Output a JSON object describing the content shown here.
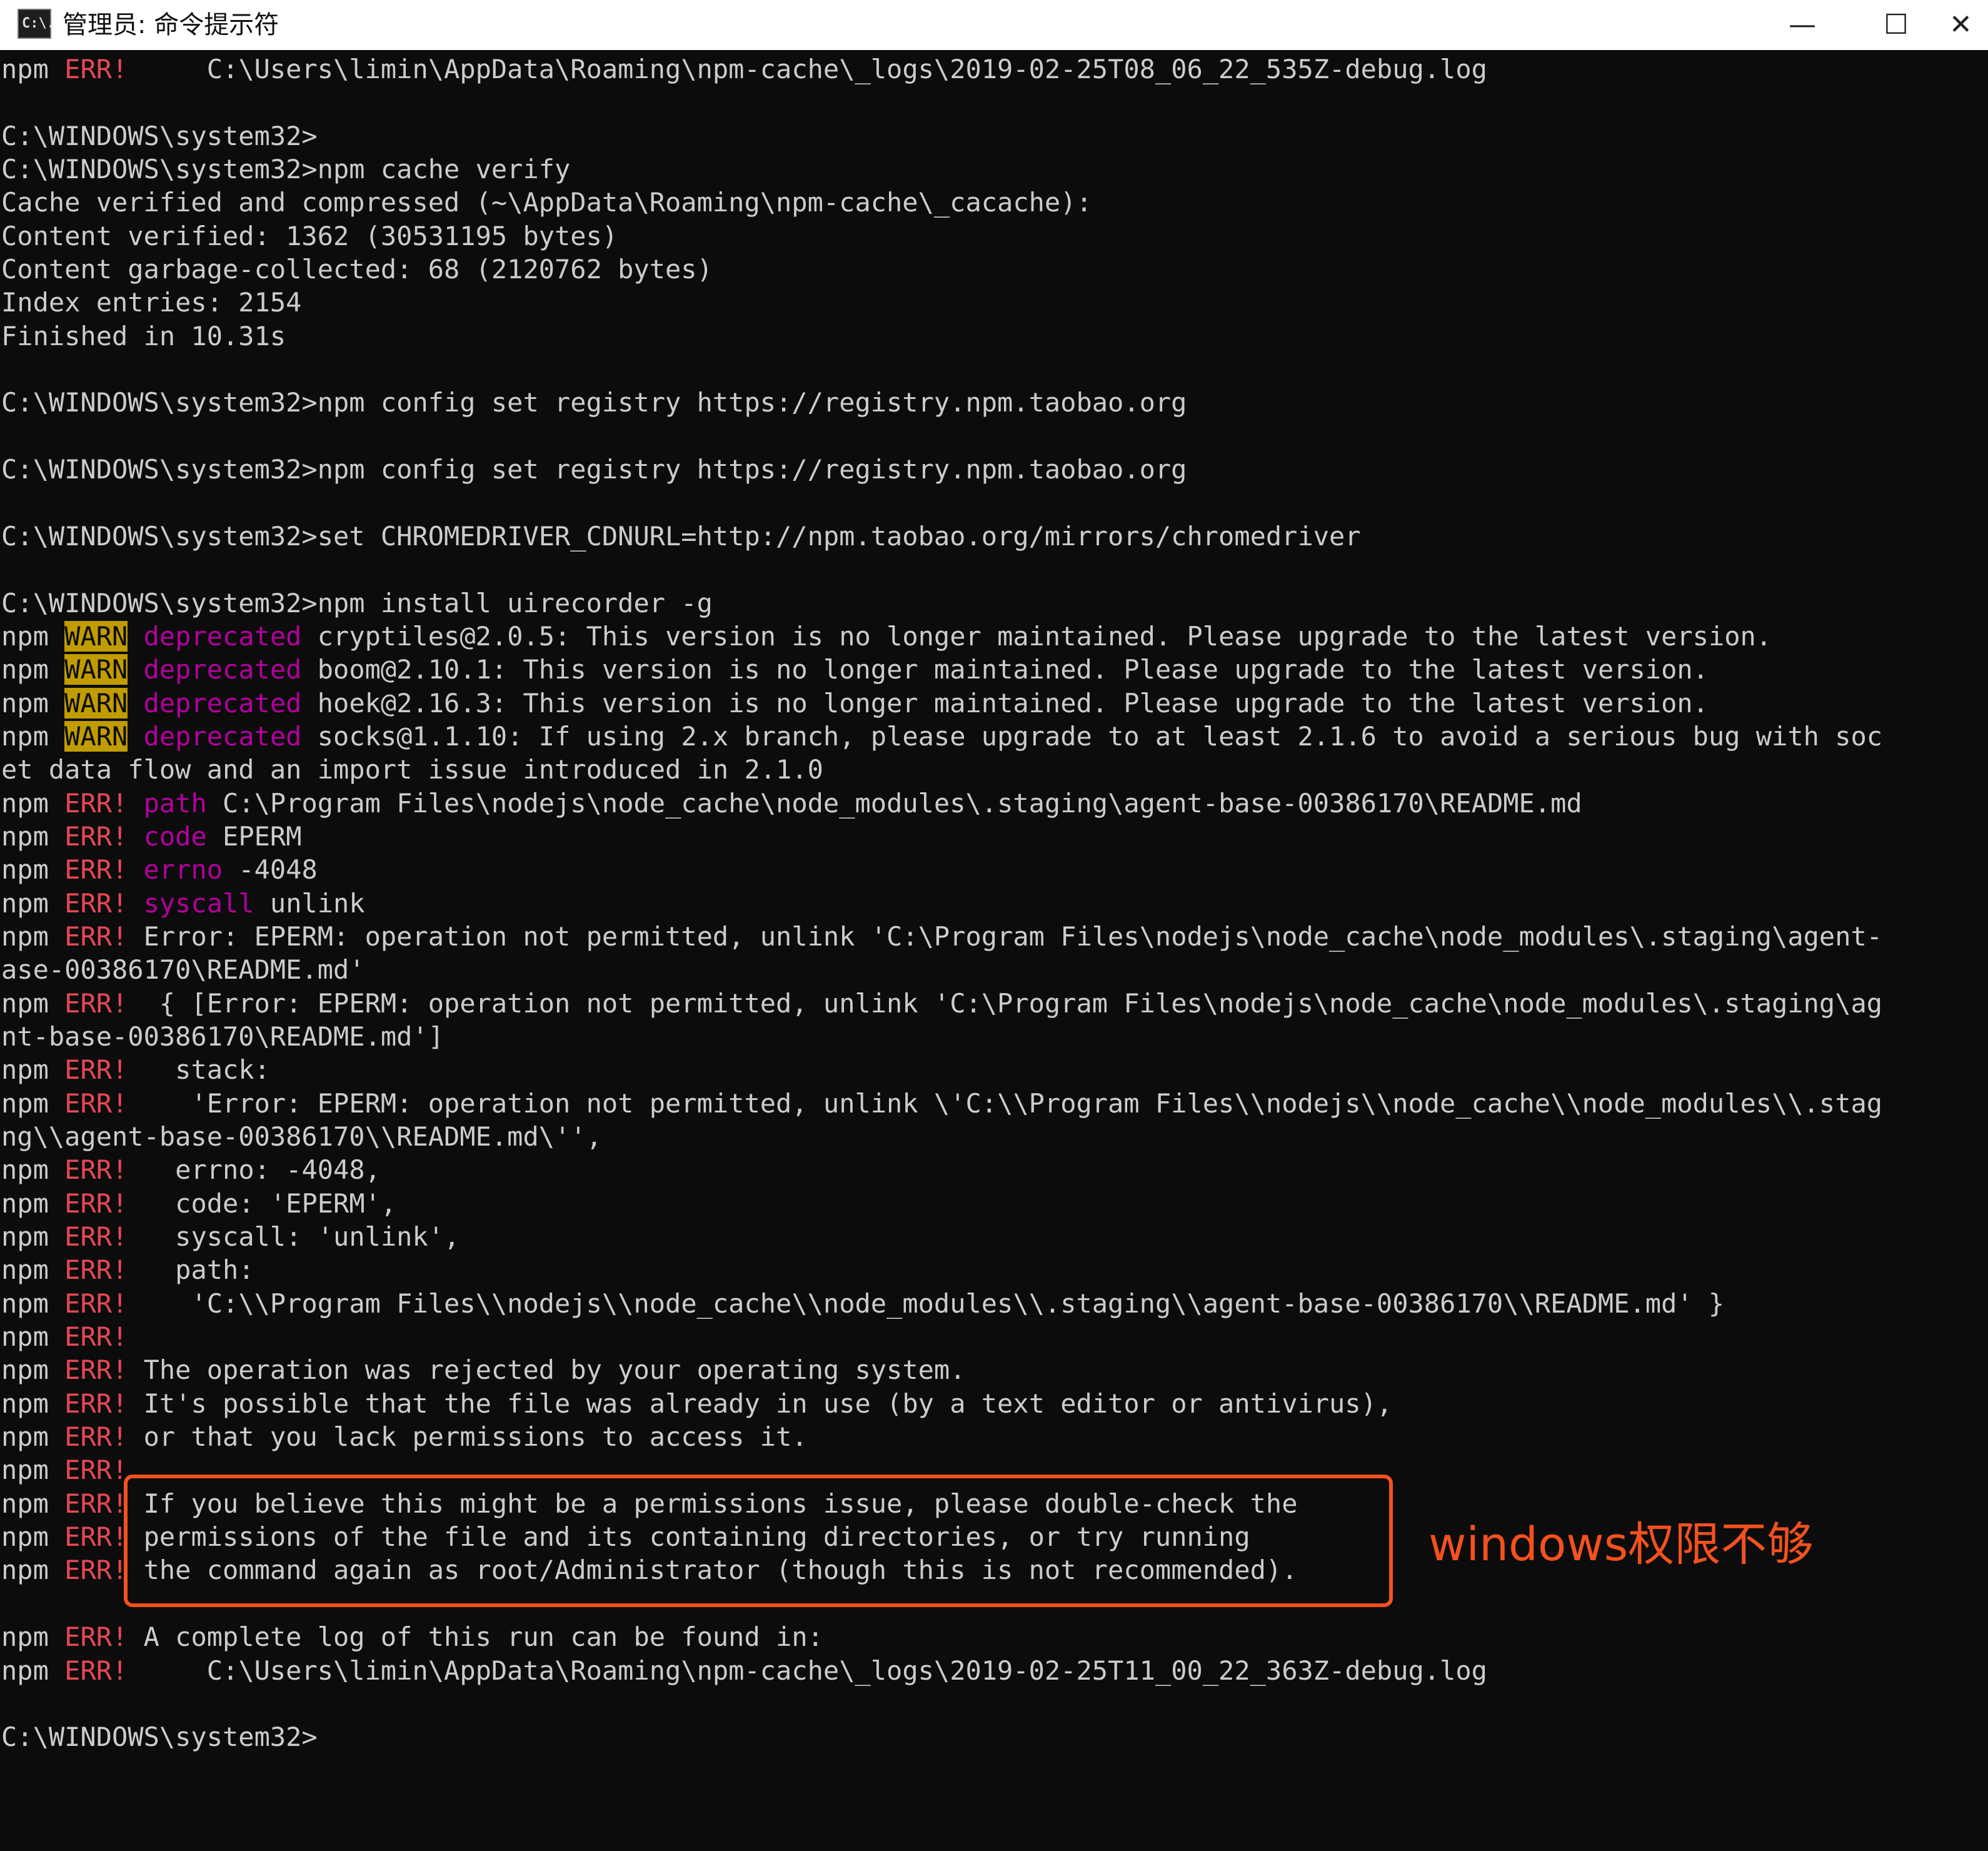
{
  "window": {
    "title": "管理员: 命令提示符",
    "icon_label": "C:\\.",
    "minimize_glyph": "—",
    "maximize_glyph": "☐",
    "close_glyph": "✕"
  },
  "colors": {
    "err": "#e74856",
    "warn_bg": "#c19c00",
    "deprecated": "#b4009e",
    "highlight": "#f4511e"
  },
  "lines": [
    [
      "npm ",
      {
        "t": "ERR!",
        "c": "err"
      },
      "     C:\\Users\\limin\\AppData\\Roaming\\npm-cache\\_logs\\2019-02-25T08_06_22_535Z-debug.log"
    ],
    [
      ""
    ],
    [
      "C:\\WINDOWS\\system32>"
    ],
    [
      "C:\\WINDOWS\\system32>npm cache verify"
    ],
    [
      "Cache verified and compressed (~\\AppData\\Roaming\\npm-cache\\_cacache):"
    ],
    [
      "Content verified: 1362 (30531195 bytes)"
    ],
    [
      "Content garbage-collected: 68 (2120762 bytes)"
    ],
    [
      "Index entries: 2154"
    ],
    [
      "Finished in 10.31s"
    ],
    [
      ""
    ],
    [
      "C:\\WINDOWS\\system32>npm config set registry https://registry.npm.taobao.org"
    ],
    [
      ""
    ],
    [
      "C:\\WINDOWS\\system32>npm config set registry https://registry.npm.taobao.org"
    ],
    [
      ""
    ],
    [
      "C:\\WINDOWS\\system32>set CHROMEDRIVER_CDNURL=http://npm.taobao.org/mirrors/chromedriver"
    ],
    [
      ""
    ],
    [
      "C:\\WINDOWS\\system32>npm install uirecorder -g"
    ],
    [
      "npm ",
      {
        "t": "WARN",
        "c": "warn"
      },
      " ",
      {
        "t": "deprecated",
        "c": "dep"
      },
      " cryptiles@2.0.5: This version is no longer maintained. Please upgrade to the latest version."
    ],
    [
      "npm ",
      {
        "t": "WARN",
        "c": "warn"
      },
      " ",
      {
        "t": "deprecated",
        "c": "dep"
      },
      " boom@2.10.1: This version is no longer maintained. Please upgrade to the latest version."
    ],
    [
      "npm ",
      {
        "t": "WARN",
        "c": "warn"
      },
      " ",
      {
        "t": "deprecated",
        "c": "dep"
      },
      " hoek@2.16.3: This version is no longer maintained. Please upgrade to the latest version."
    ],
    [
      "npm ",
      {
        "t": "WARN",
        "c": "warn"
      },
      " ",
      {
        "t": "deprecated",
        "c": "dep"
      },
      " socks@1.1.10: If using 2.x branch, please upgrade to at least 2.1.6 to avoid a serious bug with soc"
    ],
    [
      "et data flow and an import issue introduced in 2.1.0"
    ],
    [
      "npm ",
      {
        "t": "ERR!",
        "c": "err"
      },
      " ",
      {
        "t": "path",
        "c": "key"
      },
      " C:\\Program Files\\nodejs\\node_cache\\node_modules\\.staging\\agent-base-00386170\\README.md"
    ],
    [
      "npm ",
      {
        "t": "ERR!",
        "c": "err"
      },
      " ",
      {
        "t": "code",
        "c": "key"
      },
      " EPERM"
    ],
    [
      "npm ",
      {
        "t": "ERR!",
        "c": "err"
      },
      " ",
      {
        "t": "errno",
        "c": "key"
      },
      " -4048"
    ],
    [
      "npm ",
      {
        "t": "ERR!",
        "c": "err"
      },
      " ",
      {
        "t": "syscall",
        "c": "key"
      },
      " unlink"
    ],
    [
      "npm ",
      {
        "t": "ERR!",
        "c": "err"
      },
      " Error: EPERM: operation not permitted, unlink 'C:\\Program Files\\nodejs\\node_cache\\node_modules\\.staging\\agent-"
    ],
    [
      "ase-00386170\\README.md'"
    ],
    [
      "npm ",
      {
        "t": "ERR!",
        "c": "err"
      },
      "  { [Error: EPERM: operation not permitted, unlink 'C:\\Program Files\\nodejs\\node_cache\\node_modules\\.staging\\ag"
    ],
    [
      "nt-base-00386170\\README.md']"
    ],
    [
      "npm ",
      {
        "t": "ERR!",
        "c": "err"
      },
      "   stack:"
    ],
    [
      "npm ",
      {
        "t": "ERR!",
        "c": "err"
      },
      "    'Error: EPERM: operation not permitted, unlink \\'C:\\\\Program Files\\\\nodejs\\\\node_cache\\\\node_modules\\\\.stag"
    ],
    [
      "ng\\\\agent-base-00386170\\\\README.md\\'',"
    ],
    [
      "npm ",
      {
        "t": "ERR!",
        "c": "err"
      },
      "   errno: -4048,"
    ],
    [
      "npm ",
      {
        "t": "ERR!",
        "c": "err"
      },
      "   code: 'EPERM',"
    ],
    [
      "npm ",
      {
        "t": "ERR!",
        "c": "err"
      },
      "   syscall: 'unlink',"
    ],
    [
      "npm ",
      {
        "t": "ERR!",
        "c": "err"
      },
      "   path:"
    ],
    [
      "npm ",
      {
        "t": "ERR!",
        "c": "err"
      },
      "    'C:\\\\Program Files\\\\nodejs\\\\node_cache\\\\node_modules\\\\.staging\\\\agent-base-00386170\\\\README.md' }"
    ],
    [
      "npm ",
      {
        "t": "ERR!",
        "c": "err"
      }
    ],
    [
      "npm ",
      {
        "t": "ERR!",
        "c": "err"
      },
      " The operation was rejected by your operating system."
    ],
    [
      "npm ",
      {
        "t": "ERR!",
        "c": "err"
      },
      " It's possible that the file was already in use (by a text editor or antivirus),"
    ],
    [
      "npm ",
      {
        "t": "ERR!",
        "c": "err"
      },
      " or that you lack permissions to access it."
    ],
    [
      "npm ",
      {
        "t": "ERR!",
        "c": "err"
      }
    ],
    [
      "npm ",
      {
        "t": "ERR!",
        "c": "err"
      },
      " If you believe this might be a permissions issue, please double-check the"
    ],
    [
      "npm ",
      {
        "t": "ERR!",
        "c": "err"
      },
      " permissions of the file and its containing directories, or try running"
    ],
    [
      "npm ",
      {
        "t": "ERR!",
        "c": "err"
      },
      " the command again as root/Administrator (though this is not recommended)."
    ],
    [
      ""
    ],
    [
      "npm ",
      {
        "t": "ERR!",
        "c": "err"
      },
      " A complete log of this run can be found in:"
    ],
    [
      "npm ",
      {
        "t": "ERR!",
        "c": "err"
      },
      "     C:\\Users\\limin\\AppData\\Roaming\\npm-cache\\_logs\\2019-02-25T11_00_22_363Z-debug.log"
    ],
    [
      ""
    ],
    [
      "C:\\WINDOWS\\system32>"
    ]
  ],
  "annotation": {
    "text": "windows权限不够"
  }
}
